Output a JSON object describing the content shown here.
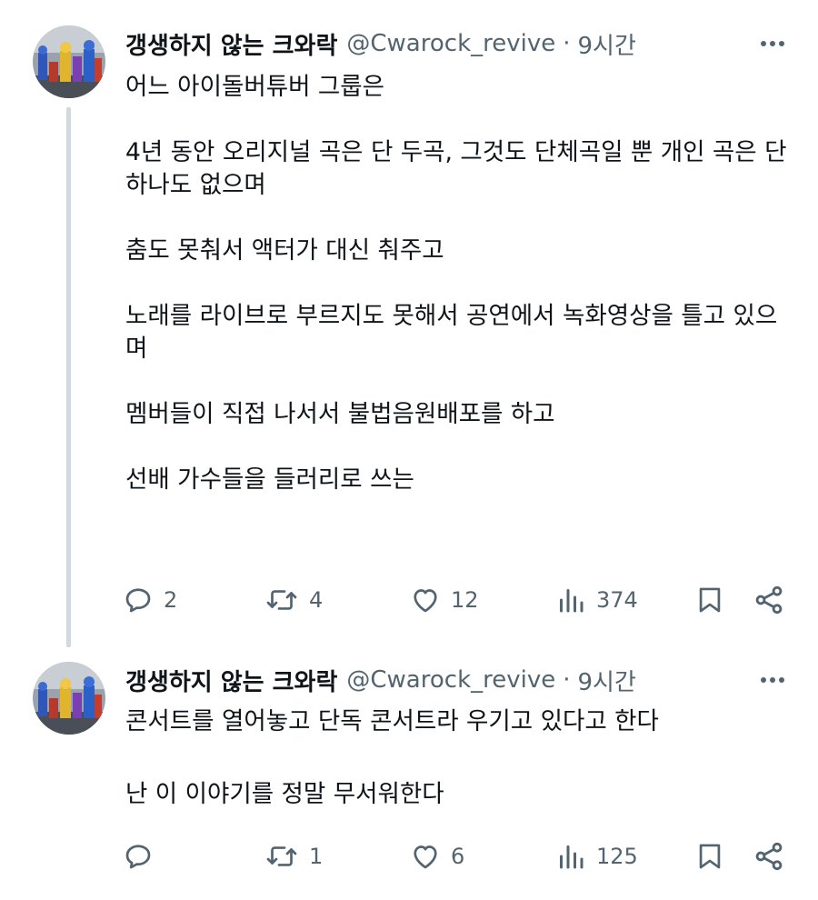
{
  "tweets": [
    {
      "author": {
        "name": "갱생하지 않는 크와락",
        "handle": "@Cwarock_revive"
      },
      "separator": "·",
      "time": "9시간",
      "lines": [
        "어느 아이돌버튜버 그룹은",
        "4년 동안 오리지널 곡은 단 두곡, 그것도 단체곡일 뿐 개인 곡은 단 하나도 없으며",
        "춤도 못춰서 액터가 대신 춰주고",
        "노래를 라이브로 부르지도 못해서 공연에서 녹화영상을 틀고 있으며",
        "멤버들이 직접 나서서 불법음원배포를 하고",
        "선배 가수들을 들러리로 쓰는"
      ],
      "stats": {
        "replies": "2",
        "retweets": "4",
        "likes": "12",
        "views": "374"
      }
    },
    {
      "author": {
        "name": "갱생하지 않는 크와락",
        "handle": "@Cwarock_revive"
      },
      "separator": "·",
      "time": "9시간",
      "lines": [
        "콘서트를 열어놓고 단독 콘서트라 우기고 있다고 한다",
        "난 이 이야기를 정말 무서워한다"
      ],
      "stats": {
        "replies": "",
        "retweets": "1",
        "likes": "6",
        "views": "125"
      }
    }
  ],
  "icons": {
    "avatar": "avatar-figures-image",
    "more": "more-icon",
    "reply": "reply-icon",
    "retweet": "retweet-icon",
    "like": "like-icon",
    "views": "views-icon",
    "bookmark": "bookmark-icon",
    "share": "share-icon"
  },
  "colors": {
    "text": "#0f1419",
    "secondary": "#536471",
    "thread_line": "#cfd9de"
  }
}
